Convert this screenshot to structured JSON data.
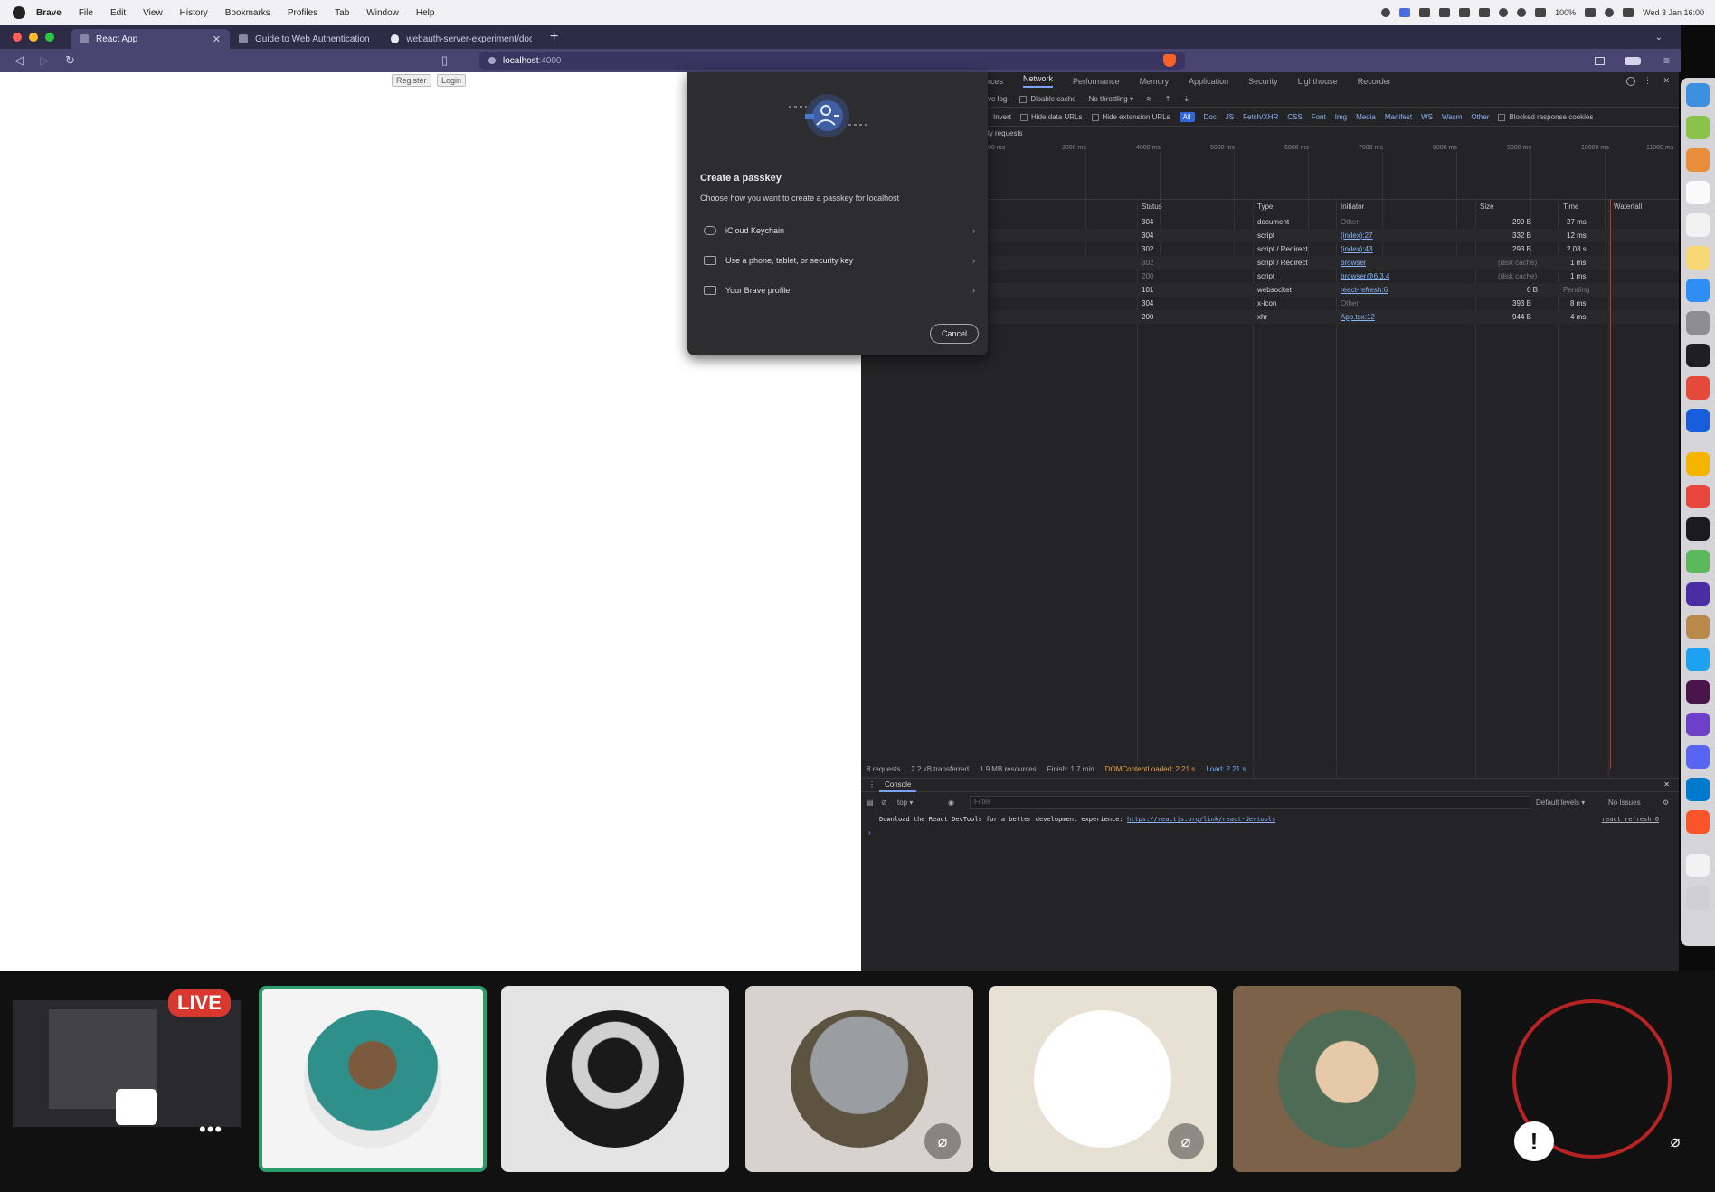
{
  "menubar": {
    "app": "Brave",
    "items": [
      "File",
      "Edit",
      "View",
      "History",
      "Bookmarks",
      "Profiles",
      "Tab",
      "Window",
      "Help"
    ],
    "clock": "Wed 3 Jan 16:00",
    "battery": "100%"
  },
  "browser": {
    "tabs": [
      {
        "label": "React App",
        "active": true
      },
      {
        "label": "Guide to Web Authentication",
        "active": false
      },
      {
        "label": "webauth-server-experiment/docs/",
        "active": false
      }
    ],
    "url_host": "localhost",
    "url_port": ":4000"
  },
  "page": {
    "register_label": "Register",
    "login_label": "Login"
  },
  "passkey": {
    "title": "Create a passkey",
    "subtitle": "Choose how you want to create a passkey for localhost",
    "options": [
      "iCloud Keychain",
      "Use a phone, tablet, or security key",
      "Your Brave profile"
    ],
    "cancel_label": "Cancel"
  },
  "devtools": {
    "tabs": [
      "Sources",
      "Network",
      "Performance",
      "Memory",
      "Application",
      "Security",
      "Lighthouse",
      "Recorder"
    ],
    "active_tab": "Network",
    "toolbar": {
      "preserve_log": "ve log",
      "disable_cache": "Disable cache",
      "throttling": "No throttling"
    },
    "filters": [
      "Invert",
      "Hide data URLs",
      "Hide extension URLs",
      "All",
      "Doc",
      "JS",
      "Fetch/XHR",
      "CSS",
      "Font",
      "Img",
      "Media",
      "Manifest",
      "WS",
      "Wasm",
      "Other",
      "Blocked response cookies"
    ],
    "third_party": "ly requests",
    "overview_ticks": [
      "00 ms",
      "3000 ms",
      "4000 ms",
      "5000 ms",
      "6000 ms",
      "7000 ms",
      "8000 ms",
      "9000 ms",
      "10000 ms",
      "11000 ms"
    ],
    "columns": [
      "Status",
      "Type",
      "Initiator",
      "Size",
      "Time",
      "Waterfall"
    ],
    "rows": [
      {
        "status": "304",
        "type": "document",
        "initiator": "Other",
        "size": "299 B",
        "time": "27 ms"
      },
      {
        "status": "304",
        "type": "script",
        "initiator": "(index):27",
        "size": "332 B",
        "time": "12 ms"
      },
      {
        "status": "302",
        "type": "script / Redirect",
        "initiator": "(index):43",
        "size": "293 B",
        "time": "2.03 s"
      },
      {
        "status": "302",
        "type": "script / Redirect",
        "initiator": "browser",
        "size": "(disk cache)",
        "time": "1 ms"
      },
      {
        "status": "200",
        "type": "script",
        "initiator": "browser@6.3.4",
        "size": "(disk cache)",
        "time": "1 ms"
      },
      {
        "status": "101",
        "type": "websocket",
        "initiator": "react-refresh:6",
        "size": "0 B",
        "time": "Pending"
      },
      {
        "status": "304",
        "type": "x-icon",
        "initiator": "Other",
        "size": "393 B",
        "time": "8 ms"
      },
      {
        "status": "200",
        "type": "xhr",
        "initiator": "App.tsx:12",
        "size": "944 B",
        "time": "4 ms"
      }
    ],
    "summary": {
      "requests": "8 requests",
      "transferred": "2.2 kB transferred",
      "resources": "1.9 MB resources",
      "finish": "Finish: 1.7 min",
      "dcl": "DOMContentLoaded: 2.21 s",
      "load": "Load: 2.21 s"
    },
    "console": {
      "title": "Console",
      "context": "top",
      "filter_placeholder": "Filter",
      "levels": "Default levels",
      "issues": "No Issues",
      "message": "Download the React DevTools for a better development experience: ",
      "message_link": "https://reactjs.org/link/react-devtools",
      "source": "react_refresh:6"
    }
  },
  "meeting": {
    "live_label": "LIVE",
    "colors": {
      "speaking_border": "#2d9c6a",
      "live": "#d9382f"
    }
  },
  "colors": {
    "tabbar": "#2e2b47",
    "addressbar": "#4a4570",
    "devtools_bg": "#242426",
    "dialog_bg": "#2d2d30",
    "link": "#8ab4f8"
  }
}
